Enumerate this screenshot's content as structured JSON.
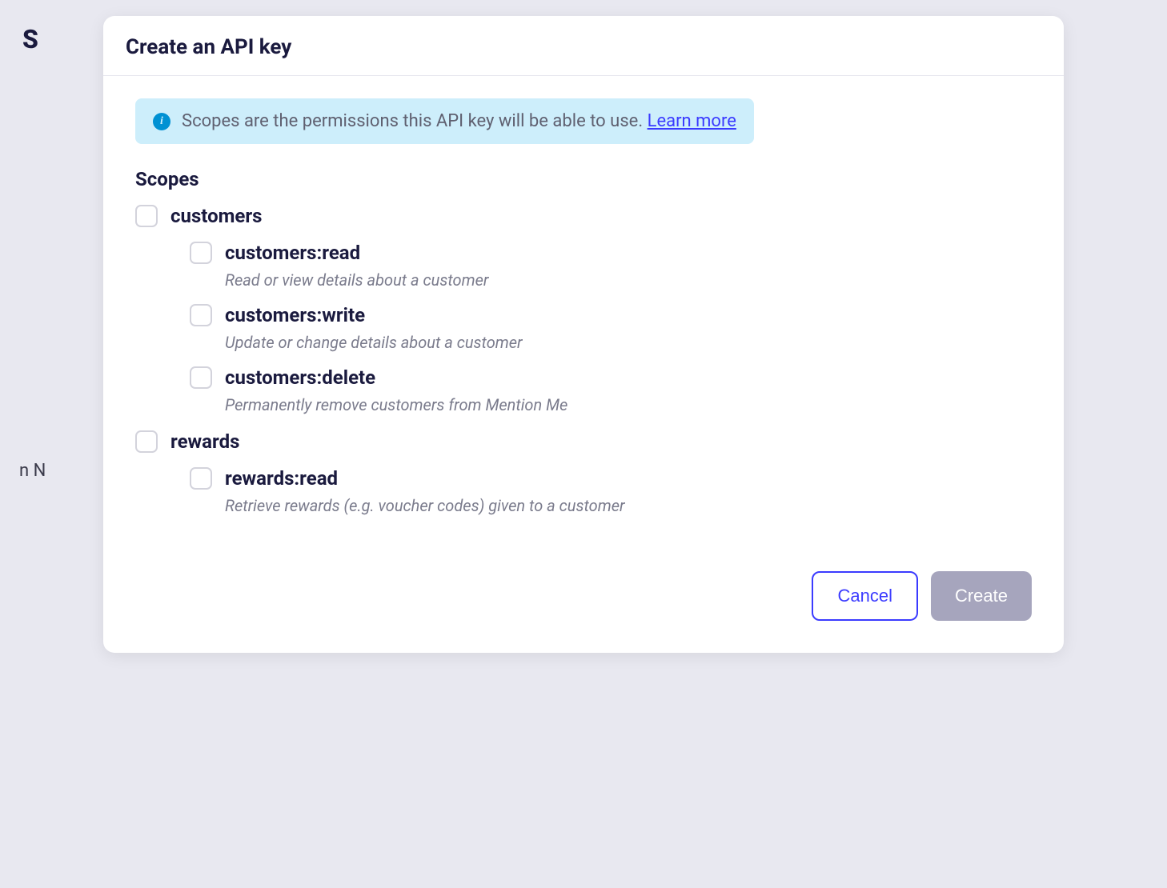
{
  "modal": {
    "title": "Create an API key",
    "info": {
      "text": "Scopes are the permissions this API key will be able to use. ",
      "link_text": "Learn more"
    },
    "section_heading": "Scopes",
    "groups": [
      {
        "name": "customers",
        "children": [
          {
            "name": "customers:read",
            "desc": "Read or view details about a customer"
          },
          {
            "name": "customers:write",
            "desc": "Update or change details about a customer"
          },
          {
            "name": "customers:delete",
            "desc": "Permanently remove customers from Mention Me"
          }
        ]
      },
      {
        "name": "rewards",
        "children": [
          {
            "name": "rewards:read",
            "desc": "Retrieve rewards (e.g. voucher codes) given to a customer"
          }
        ]
      }
    ],
    "buttons": {
      "cancel": "Cancel",
      "create": "Create"
    }
  },
  "background_hints": {
    "s": "S",
    "n": "n N"
  }
}
